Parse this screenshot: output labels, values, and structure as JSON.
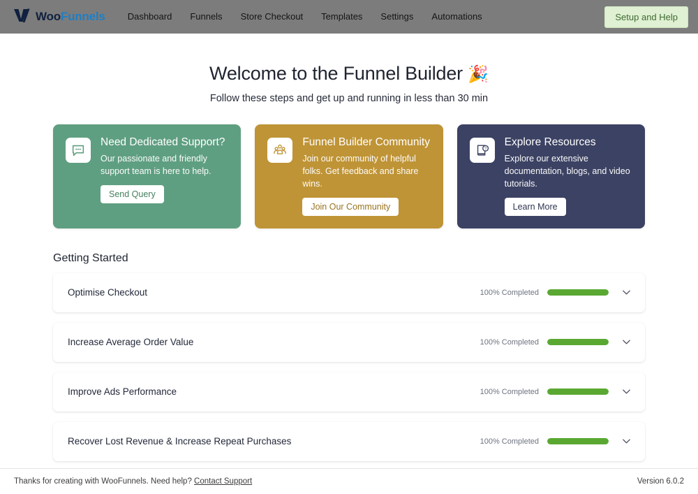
{
  "header": {
    "brand": {
      "logo_icon": "woofunnels-v-logo-icon",
      "name_first": "Woo",
      "name_second": "Funnels"
    },
    "nav": [
      {
        "label": "Dashboard"
      },
      {
        "label": "Funnels"
      },
      {
        "label": "Store Checkout"
      },
      {
        "label": "Templates"
      },
      {
        "label": "Settings"
      },
      {
        "label": "Automations"
      }
    ],
    "setup_help_label": "Setup and Help",
    "background_color": "#7c7c7c",
    "setup_help_bg": "#dff0d3",
    "setup_help_color": "#3f6b33"
  },
  "hero": {
    "title": "Welcome to the Funnel Builder",
    "title_emoji": "🎉",
    "subtitle": "Follow these steps and get up and running in less than 30 min"
  },
  "cards": [
    {
      "id": "support",
      "icon": "chat-bubble-icon",
      "title": "Need Dedicated Support?",
      "description": "Our passionate and friendly support team is here to help.",
      "button_label": "Send Query",
      "color": "#5f9f81",
      "button_text_color": "#44805f"
    },
    {
      "id": "community",
      "icon": "people-group-icon",
      "title": "Funnel Builder Community",
      "description": "Join our community of helpful folks. Get feedback and share wins.",
      "button_label": "Join Our Community",
      "color": "#bf9436",
      "button_text_color": "#9a7420"
    },
    {
      "id": "resources",
      "icon": "book-question-icon",
      "title": "Explore Resources",
      "description": "Explore our extensive documentation, blogs, and video tutorials.",
      "button_label": "Learn More",
      "color": "#3c4263",
      "button_text_color": "#2f3552"
    }
  ],
  "getting_started": {
    "section_title": "Getting Started",
    "progress_bar_color": "#5aa832",
    "rows": [
      {
        "label": "Optimise Checkout",
        "progress_label": "100% Completed",
        "progress_value": 100,
        "chevron": "chevron-down-icon"
      },
      {
        "label": "Increase Average Order Value",
        "progress_label": "100% Completed",
        "progress_value": 100,
        "chevron": "chevron-down-icon"
      },
      {
        "label": "Improve Ads Performance",
        "progress_label": "100% Completed",
        "progress_value": 100,
        "chevron": "chevron-down-icon"
      },
      {
        "label": "Recover Lost Revenue & Increase Repeat Purchases",
        "progress_label": "100% Completed",
        "progress_value": 100,
        "chevron": "chevron-down-icon"
      }
    ]
  },
  "footer": {
    "text": "Thanks for creating with WooFunnels. Need help?",
    "link_label": "Contact Support",
    "version": "Version 6.0.2"
  }
}
